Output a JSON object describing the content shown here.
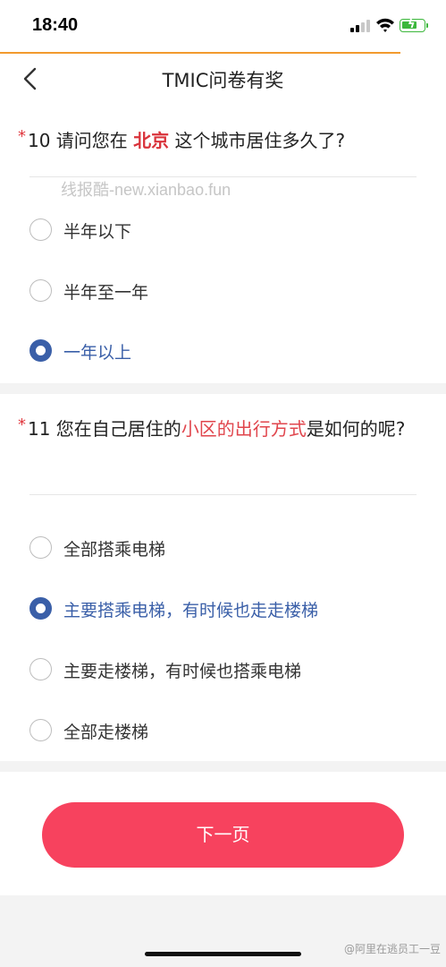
{
  "status": {
    "time": "18:40"
  },
  "nav": {
    "title": "TMIC问卷有奖"
  },
  "q10": {
    "star": "*",
    "prefix": "10 请问您在 ",
    "city": "北京",
    "suffix": " 这个城市居住多久了?",
    "watermark": "线报酷-new.xianbao.fun",
    "options": [
      "半年以下",
      "半年至一年",
      "一年以上"
    ],
    "selected_index": 2
  },
  "q11": {
    "star": "*",
    "prefix": "11 您在自己居住的",
    "highlight": "小区的出行方式",
    "suffix": "是如何的呢?",
    "options": [
      "全部搭乘电梯",
      "主要搭乘电梯，有时候也走走楼梯",
      "主要走楼梯，有时候也搭乘电梯",
      "全部走楼梯"
    ],
    "selected_index": 1
  },
  "footer": {
    "next_label": "下一页",
    "weibo_watermark": "@阿里在逃员工一豆"
  },
  "colors": {
    "accent": "#3a5fa8",
    "button": "#f7425e",
    "required": "#e0383e",
    "top_line": "#f29a2e"
  }
}
